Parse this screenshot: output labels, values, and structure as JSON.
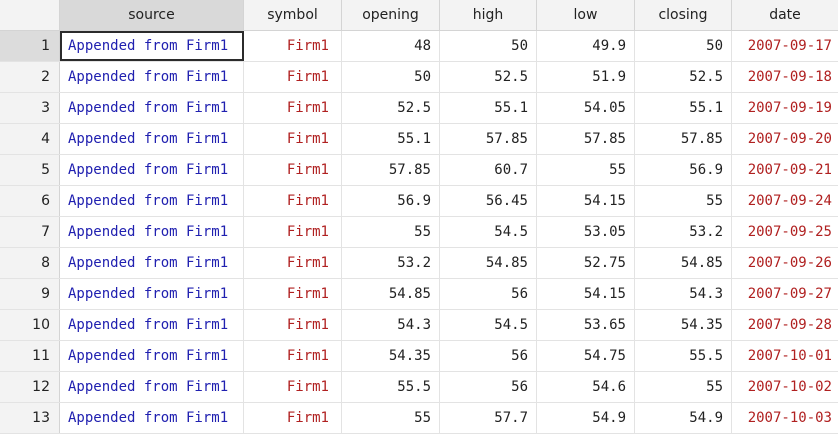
{
  "columns": [
    "source",
    "symbol",
    "opening",
    "high",
    "low",
    "closing",
    "date"
  ],
  "rows": [
    {
      "n": "1",
      "source": "Appended from Firm1",
      "symbol": "Firm1",
      "opening": "48",
      "high": "50",
      "low": "49.9",
      "closing": "50",
      "date": "2007-09-17"
    },
    {
      "n": "2",
      "source": "Appended from Firm1",
      "symbol": "Firm1",
      "opening": "50",
      "high": "52.5",
      "low": "51.9",
      "closing": "52.5",
      "date": "2007-09-18"
    },
    {
      "n": "3",
      "source": "Appended from Firm1",
      "symbol": "Firm1",
      "opening": "52.5",
      "high": "55.1",
      "low": "54.05",
      "closing": "55.1",
      "date": "2007-09-19"
    },
    {
      "n": "4",
      "source": "Appended from Firm1",
      "symbol": "Firm1",
      "opening": "55.1",
      "high": "57.85",
      "low": "57.85",
      "closing": "57.85",
      "date": "2007-09-20"
    },
    {
      "n": "5",
      "source": "Appended from Firm1",
      "symbol": "Firm1",
      "opening": "57.85",
      "high": "60.7",
      "low": "55",
      "closing": "56.9",
      "date": "2007-09-21"
    },
    {
      "n": "6",
      "source": "Appended from Firm1",
      "symbol": "Firm1",
      "opening": "56.9",
      "high": "56.45",
      "low": "54.15",
      "closing": "55",
      "date": "2007-09-24"
    },
    {
      "n": "7",
      "source": "Appended from Firm1",
      "symbol": "Firm1",
      "opening": "55",
      "high": "54.5",
      "low": "53.05",
      "closing": "53.2",
      "date": "2007-09-25"
    },
    {
      "n": "8",
      "source": "Appended from Firm1",
      "symbol": "Firm1",
      "opening": "53.2",
      "high": "54.85",
      "low": "52.75",
      "closing": "54.85",
      "date": "2007-09-26"
    },
    {
      "n": "9",
      "source": "Appended from Firm1",
      "symbol": "Firm1",
      "opening": "54.85",
      "high": "56",
      "low": "54.15",
      "closing": "54.3",
      "date": "2007-09-27"
    },
    {
      "n": "10",
      "source": "Appended from Firm1",
      "symbol": "Firm1",
      "opening": "54.3",
      "high": "54.5",
      "low": "53.65",
      "closing": "54.35",
      "date": "2007-09-28"
    },
    {
      "n": "11",
      "source": "Appended from Firm1",
      "symbol": "Firm1",
      "opening": "54.35",
      "high": "56",
      "low": "54.75",
      "closing": "55.5",
      "date": "2007-10-01"
    },
    {
      "n": "12",
      "source": "Appended from Firm1",
      "symbol": "Firm1",
      "opening": "55.5",
      "high": "56",
      "low": "54.6",
      "closing": "55",
      "date": "2007-10-02"
    },
    {
      "n": "13",
      "source": "Appended from Firm1",
      "symbol": "Firm1",
      "opening": "55",
      "high": "57.7",
      "low": "54.9",
      "closing": "54.9",
      "date": "2007-10-03"
    }
  ],
  "colors": {
    "string_var": "#2020b0",
    "value_label_var": "#b02020",
    "header_bg": "#f3f3f3"
  }
}
